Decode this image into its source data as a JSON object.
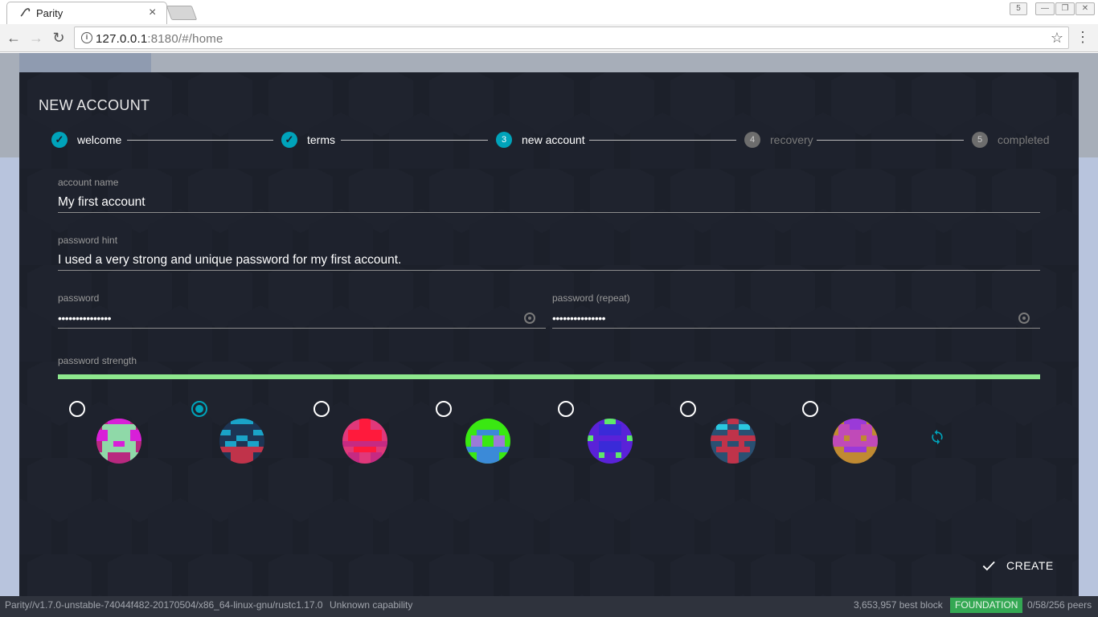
{
  "browser": {
    "tab_title": "Parity",
    "url_host": "127.0.0.1",
    "url_rest": ":8180/#/home"
  },
  "modal": {
    "title": "NEW ACCOUNT",
    "steps": [
      {
        "index": "",
        "label": "welcome",
        "state": "done"
      },
      {
        "index": "",
        "label": "terms",
        "state": "done"
      },
      {
        "index": "3",
        "label": "new account",
        "state": "active"
      },
      {
        "index": "4",
        "label": "recovery",
        "state": "pending"
      },
      {
        "index": "5",
        "label": "completed",
        "state": "pending"
      }
    ],
    "fields": {
      "account_name_label": "account name",
      "account_name_value": "My first account",
      "password_hint_label": "password hint",
      "password_hint_value": "I used a very strong and unique password for my first account.",
      "password_label": "password",
      "password_value": "•••••••••••••••",
      "password_repeat_label": "password (repeat)",
      "password_repeat_value": "•••••••••••••••",
      "password_strength_label": "password strength",
      "password_strength_fraction": 1.0
    },
    "identicons": {
      "selected_index": 1,
      "count": 7
    },
    "create_label": "CREATE"
  },
  "colors": {
    "accent": "#00a3ba",
    "modal_bg": "#1c202a",
    "strength": "#8ee88e",
    "chain_badge": "#34a853"
  },
  "statusbar": {
    "version": "Parity//v1.7.0-unstable-74044f482-20170504/x86_64-linux-gnu/rustc1.17.0",
    "capability": "Unknown capability",
    "best_block": "3,653,957 best block",
    "chain": "FOUNDATION",
    "peers": "0/58/256 peers"
  }
}
